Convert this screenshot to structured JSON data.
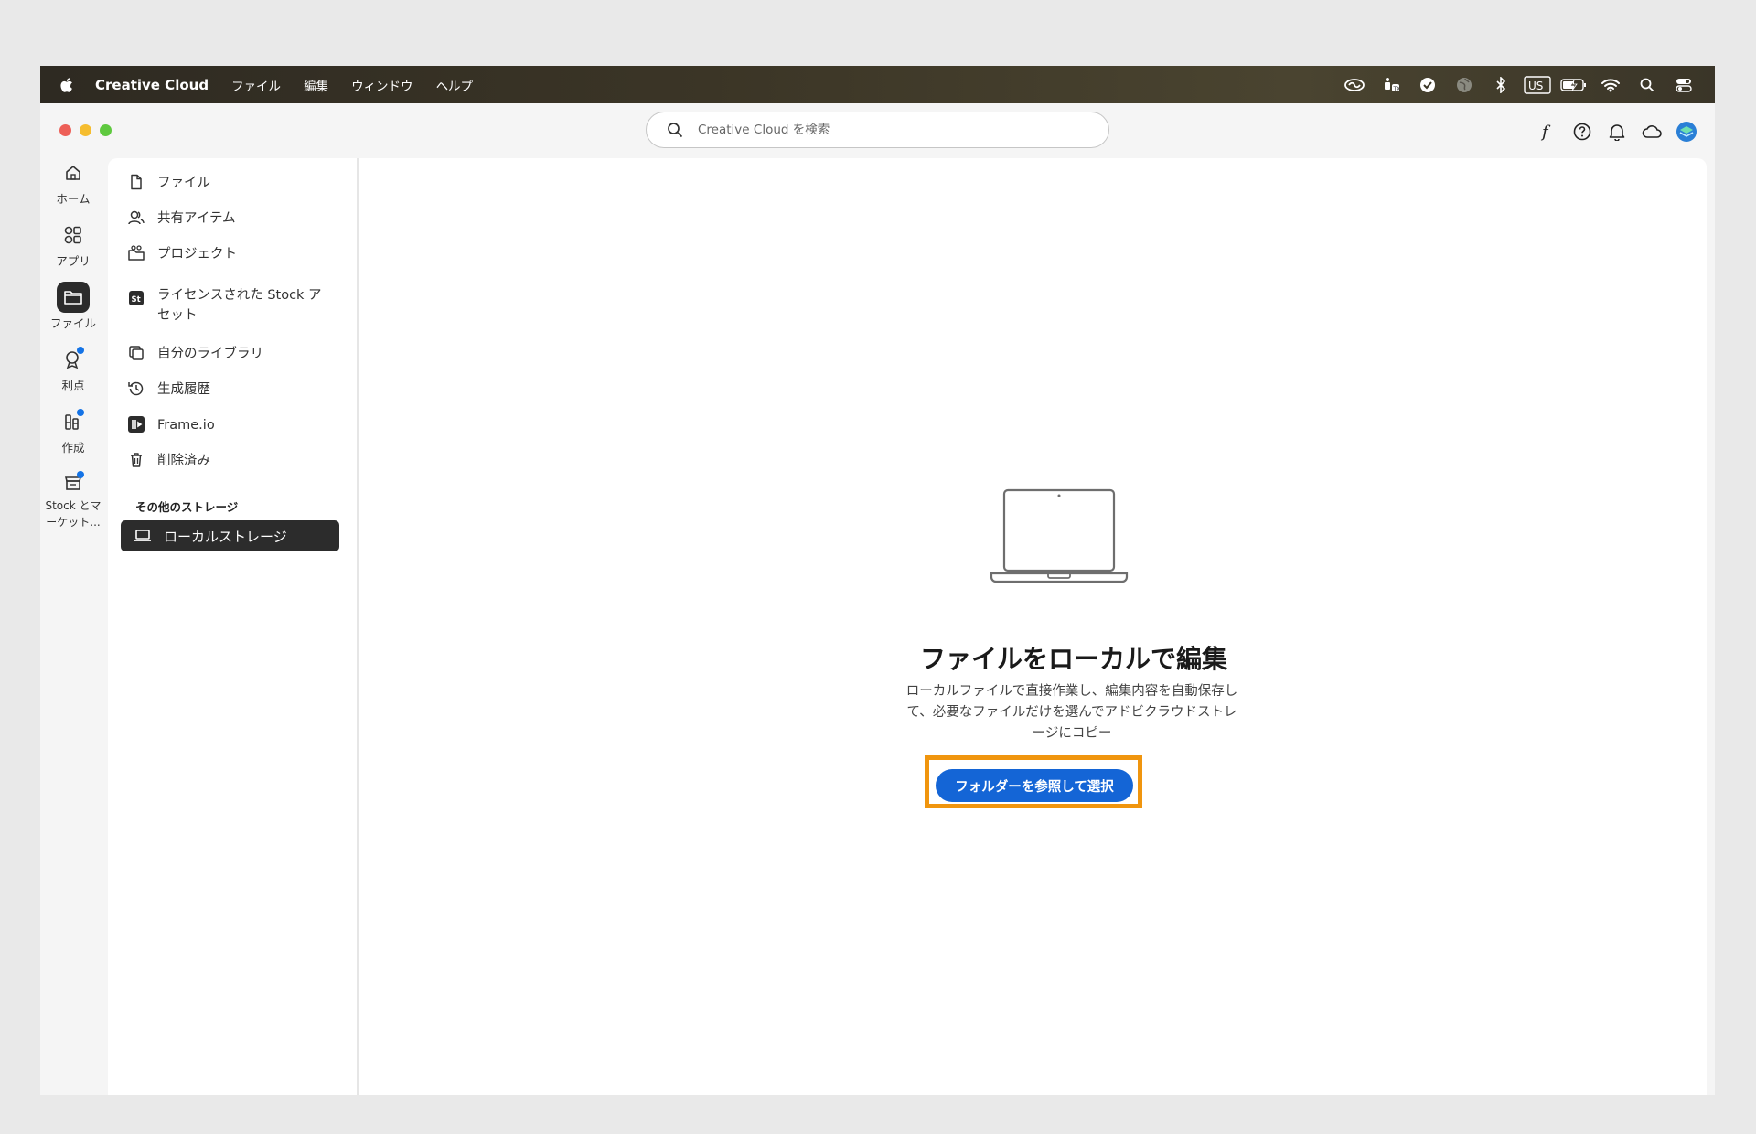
{
  "menubar": {
    "app_name": "Creative Cloud",
    "menus": [
      "ファイル",
      "編集",
      "ウィンドウ",
      "ヘルプ"
    ],
    "status_icons": [
      "creative-cloud-icon",
      "accessibility-icon",
      "check-circle-icon",
      "globe-icon",
      "bluetooth-icon",
      "input-source-icon",
      "battery-icon",
      "wifi-icon",
      "spotlight-search-icon",
      "control-center-icon"
    ],
    "input_source": "US"
  },
  "search": {
    "placeholder": "Creative Cloud を検索"
  },
  "toolbar_icons": [
    "fonts-icon",
    "help-icon",
    "bell-icon",
    "cloud-icon",
    "avatar"
  ],
  "rail": {
    "items": [
      {
        "label": "ホーム",
        "icon": "home-icon"
      },
      {
        "label": "アプリ",
        "icon": "apps-icon"
      },
      {
        "label": "ファイル",
        "icon": "folder-icon",
        "active": true
      },
      {
        "label": "利点",
        "icon": "benefits-icon",
        "badge": true
      },
      {
        "label": "作成",
        "icon": "create-icon",
        "badge": true
      },
      {
        "label": "Stock とマーケット...",
        "icon": "stock-market-icon",
        "badge": true
      }
    ]
  },
  "files_nav": {
    "items": [
      {
        "label": "ファイル",
        "icon": "document-icon"
      },
      {
        "label": "共有アイテム",
        "icon": "shared-users-icon"
      },
      {
        "label": "プロジェクト",
        "icon": "project-icon"
      },
      {
        "label": "ライセンスされた Stock アセット",
        "icon": "stock-icon"
      },
      {
        "label": "自分のライブラリ",
        "icon": "library-icon"
      },
      {
        "label": "生成履歴",
        "icon": "history-icon"
      },
      {
        "label": "Frame.io",
        "icon": "frameio-icon"
      },
      {
        "label": "削除済み",
        "icon": "trash-icon"
      }
    ],
    "section_heading": "その他のストレージ",
    "active_item": {
      "label": "ローカルストレージ",
      "icon": "laptop-icon"
    }
  },
  "main": {
    "title": "ファイルをローカルで編集",
    "description": "ローカルファイルで直接作業し、編集内容を自動保存して、必要なファイルだけを選んでアドビクラウドストレージにコピー",
    "button_label": "フォルダーを参照して選択"
  },
  "colors": {
    "accent": "#1465d6",
    "highlight": "#f0950e",
    "badge": "#1473e6",
    "active_bg": "#2c2c2c"
  }
}
